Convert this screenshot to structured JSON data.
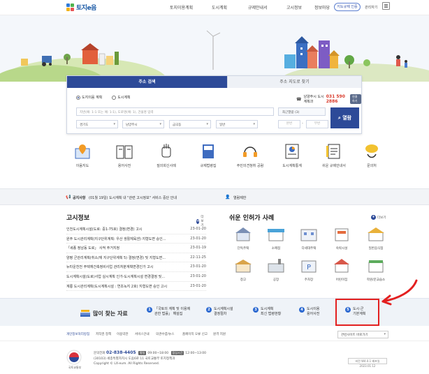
{
  "header": {
    "logo_text": "토지e음",
    "nav": [
      "토지이용계획",
      "도시계획",
      "규제안내서",
      "고시정보",
      "정보마당"
    ],
    "nav_x": [],
    "login_button": "지도규제 인증",
    "admin_link": "관리자기"
  },
  "search": {
    "tab_active": "주소 검색",
    "tab_inactive": "주소 지도로 찾기",
    "radio_land": "도지이음 계획",
    "radio_city": "도시계획",
    "phone_label": "남양주시 도시계획과",
    "phone_number": "031 590 2886",
    "phone_button": "연결하기",
    "address_placeholder": "지번(예: 1-1 또는 예: 1-1), 도로명(예: 1), 건물명 입력",
    "recent_label": "최근열람 (3)",
    "search_button": "열람",
    "selects": [
      "경기도",
      "남양주시",
      "금곡동",
      "일반"
    ],
    "num1": "본번",
    "num2": "부번"
  },
  "quick_icons": [
    "이음지도",
    "용어사전",
    "질의회신사례",
    "규제법령집",
    "주민의견청취 공람",
    "도시계획통계",
    "쉬운 규제안내서",
    "문의처"
  ],
  "notice": {
    "label": "공지사항",
    "text": "(01월 19일) 도시계획 내 \"관련 고시정보\" 서비스 중단 안내",
    "user_label": "열람제한"
  },
  "announcements": {
    "title": "고시정보",
    "more": "더보기",
    "rows": [
      {
        "title": "인천도시계획시설(도로: 중1-75호) 결정(변경) 고시",
        "date": "23-01-20"
      },
      {
        "title": "원주 도시관리계획(지구단위계획: 우산 생활체육센) 지형도면 승인...",
        "date": "23-01-20"
      },
      {
        "title": "「세종 정남동 도로」 사적 주거지정",
        "date": "23-01-19"
      },
      {
        "title": "양평 군관리계획(취소/재 지구단위계획 5) 결정(변경) 및 지형도면...",
        "date": "22-11-25"
      },
      {
        "title": "뉴타운천전 주택재건축정비사업 관리처분계획변경인가 고시",
        "date": "23-01-20"
      },
      {
        "title": "도시계획시설(도로)사업 실시계획 인가-도시계획시설 변경결정 및...",
        "date": "23-01-20"
      },
      {
        "title": "계룡 도시관리계획(도시계획시설 : 연초녹지 2호) 지형도면 승인 고시",
        "date": "23-01-20"
      }
    ]
  },
  "law_cases": {
    "title": "쉬운 인허가 사례",
    "more": "더보기",
    "items": [
      "단독주택",
      "소매점",
      "다세대주택",
      "숙박시설",
      "일반음식점",
      "창고",
      "공장",
      "주차장",
      "어린이집",
      "학원/문교습소"
    ]
  },
  "bottom": {
    "title": "많이 찾는 자료",
    "items": [
      {
        "num": "1",
        "line1": "「국토의 계획 및 이용에",
        "line2": "관한 법률」 해설집"
      },
      {
        "num": "2",
        "line1": "도시계획시설",
        "line2": "결정절차"
      },
      {
        "num": "3",
        "line1": "도시계획",
        "line2": "최신 법령현황"
      },
      {
        "num": "4",
        "line1": "도시이용",
        "line2": "용어사전"
      },
      {
        "num": "5",
        "line1": "도시·군",
        "line2": "기본계획"
      }
    ]
  },
  "footer_links": [
    "개인정보처리방침",
    "저작권 정책",
    "이용약관",
    "서비스안내",
    "의견수렴/뉴스",
    "홈페이지 오류 신고",
    "원격 지원"
  ],
  "footer_select": "관련사이트 바로가기",
  "footer": {
    "emblem_label": "국토교통부",
    "phone_label": "문의전화",
    "phone": "02-838-4405",
    "weekday_badge": "평일",
    "weekday_hours": "09:00~18:00",
    "lunch_badge": "점심시간",
    "lunch_hours": "12:00~13:00",
    "address": "(30103) 세종특별자치시 도움6로 11  국토교통부 토지정책과",
    "copyright": "Copyright © LX-eum. All Rights Reserved.",
    "version_btn": "버전 W4.0.1 배포일 2023.01.12"
  },
  "colors": {
    "primary": "#2d4a98",
    "accent_red": "#e32020",
    "phone_red": "#d93a2b"
  }
}
